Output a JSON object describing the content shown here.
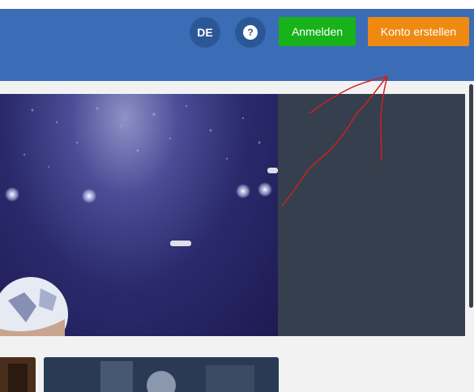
{
  "header": {
    "language_label": "DE",
    "help_icon": "question-icon",
    "login_label": "Anmelden",
    "signup_label": "Konto erstellen"
  },
  "colors": {
    "header_bg": "#3a6db5",
    "login_bg": "#18b21b",
    "signup_bg": "#ee8a12",
    "side_panel_bg": "#353f4e",
    "annotation": "#d21f1f"
  }
}
